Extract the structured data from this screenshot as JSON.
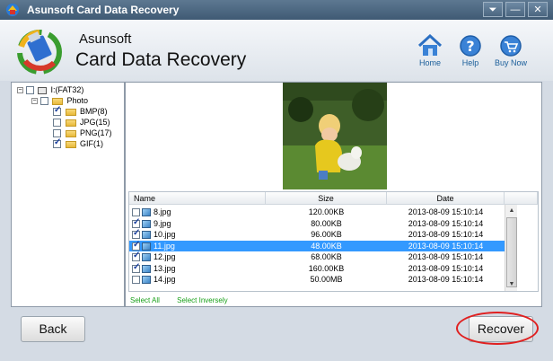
{
  "window": {
    "title": "Asunsoft Card Data Recovery",
    "controls": [
      "⏷",
      "—",
      "✕"
    ]
  },
  "header": {
    "brand_line1": "Asunsoft",
    "brand_line2": "Card Data Recovery",
    "buttons": {
      "home": "Home",
      "help": "Help",
      "buy": "Buy Now"
    }
  },
  "tree": {
    "drive": "I:(FAT32)",
    "folder": "Photo",
    "items": [
      {
        "label": "BMP(8)",
        "checked": true
      },
      {
        "label": "JPG(15)",
        "checked": false
      },
      {
        "label": "PNG(17)",
        "checked": false
      },
      {
        "label": "GIF(1)",
        "checked": true
      }
    ]
  },
  "list": {
    "columns": [
      "Name",
      "Size",
      "Date"
    ],
    "rows": [
      {
        "name": "8.jpg",
        "size": "120.00KB",
        "date": "2013-08-09 15:10:14",
        "checked": false,
        "selected": false
      },
      {
        "name": "9.jpg",
        "size": "80.00KB",
        "date": "2013-08-09 15:10:14",
        "checked": true,
        "selected": false
      },
      {
        "name": "10.jpg",
        "size": "96.00KB",
        "date": "2013-08-09 15:10:14",
        "checked": true,
        "selected": false
      },
      {
        "name": "11.jpg",
        "size": "48.00KB",
        "date": "2013-08-09 15:10:14",
        "checked": true,
        "selected": true
      },
      {
        "name": "12.jpg",
        "size": "68.00KB",
        "date": "2013-08-09 15:10:14",
        "checked": true,
        "selected": false
      },
      {
        "name": "13.jpg",
        "size": "160.00KB",
        "date": "2013-08-09 15:10:14",
        "checked": true,
        "selected": false
      },
      {
        "name": "14.jpg",
        "size": "50.00MB",
        "date": "2013-08-09 15:10:14",
        "checked": false,
        "selected": false
      }
    ]
  },
  "links": {
    "select_all": "Select All",
    "select_inversely": "Select Inversely"
  },
  "footer": {
    "back": "Back",
    "recover": "Recover"
  },
  "colors": {
    "selection": "#3399ff",
    "link_green": "#18a018",
    "highlight_ring": "#e02020"
  }
}
